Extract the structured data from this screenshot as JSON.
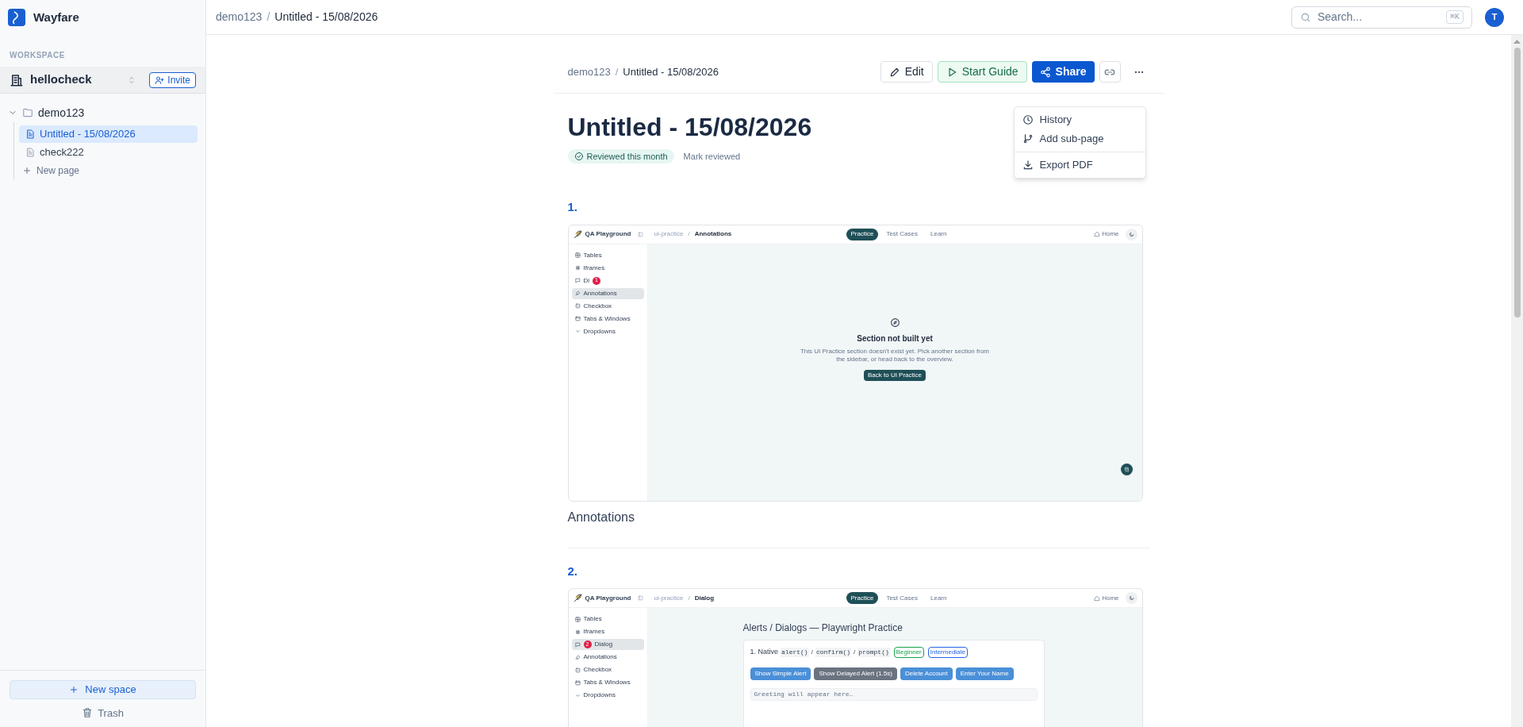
{
  "app": {
    "name": "Wayfare"
  },
  "sidebar": {
    "section_label": "WORKSPACE",
    "workspace": "hellocheck",
    "invite_button": "Invite",
    "tree": [
      {
        "label": "demo123",
        "kind": "folder",
        "expanded": true,
        "children": [
          {
            "label": "Untitled - 15/08/2026",
            "kind": "page",
            "selected": true
          },
          {
            "label": "check222",
            "kind": "page",
            "selected": false
          }
        ]
      }
    ],
    "new_page": "New page",
    "new_space_button": "New space",
    "trash": "Trash"
  },
  "top_bar": {
    "breadcrumb": [
      "demo123",
      "Untitled - 15/08/2026"
    ],
    "separator": "/",
    "search": {
      "placeholder": "Search...",
      "shortcut": "⌘K"
    },
    "avatar": "T"
  },
  "document": {
    "breadcrumb": [
      "demo123",
      "Untitled - 15/08/2026"
    ],
    "separator": "/",
    "actions": [
      {
        "kind": "edit",
        "label": "Edit"
      },
      {
        "kind": "guide",
        "label": "Start Guide"
      },
      {
        "kind": "share",
        "label": "Share"
      },
      {
        "kind": "link"
      },
      {
        "kind": "more"
      }
    ],
    "menu": [
      {
        "kind": "history",
        "label": "History",
        "divider_before": false
      },
      {
        "kind": "subpage",
        "label": "Add sub-page",
        "divider_before": false
      },
      {
        "kind": "export",
        "label": "Export PDF",
        "divider_before": true
      }
    ],
    "title": "Untitled - 15/08/2026",
    "review_badge": "Reviewed this month",
    "mark_reviewed": "Mark reviewed",
    "steps": [
      {
        "number": "1.",
        "caption": "Annotations",
        "screenshot": {
          "brand": "QA Playground",
          "breadcrumb": [
            "ui-practice",
            "Annotations"
          ],
          "separator": "/",
          "tabs": [
            {
              "label": "Practice",
              "selected": true
            },
            {
              "label": "Test Cases",
              "selected": false
            },
            {
              "label": "Learn",
              "selected": false
            }
          ],
          "home": "Home",
          "nav": [
            {
              "kind": "table",
              "label": "Tables",
              "selected": false
            },
            {
              "kind": "frames",
              "label": "Iframes",
              "selected": false
            },
            {
              "kind": "dialog",
              "label": "Di",
              "selected": false,
              "click_badge": "1"
            },
            {
              "kind": "annotate",
              "label": "Annotations",
              "selected": true
            },
            {
              "kind": "checkbox",
              "label": "Checkbox",
              "selected": false
            },
            {
              "kind": "window",
              "label": "Tabs & Windows",
              "selected": false
            },
            {
              "kind": "group",
              "label": "Dropdowns",
              "selected": false
            }
          ],
          "content": {
            "kind": "empty",
            "title": "Section not built yet",
            "text": "This UI Practice section doesn't exist yet. Pick another section from the sidebar, or head back to the overview.",
            "button": "Back to UI Practice"
          }
        }
      },
      {
        "number": "2.",
        "screenshot": {
          "brand": "QA Playground",
          "breadcrumb": [
            "ui-practice",
            "Dialog"
          ],
          "separator": "/",
          "tabs": [
            {
              "label": "Practice",
              "selected": true
            },
            {
              "label": "Test Cases",
              "selected": false
            },
            {
              "label": "Learn",
              "selected": false
            }
          ],
          "home": "Home",
          "nav": [
            {
              "kind": "table",
              "label": "Tables",
              "selected": false
            },
            {
              "kind": "frames",
              "label": "Iframes",
              "selected": false
            },
            {
              "kind": "dialog",
              "label": "Dialog",
              "selected": true,
              "click_badge": "2"
            },
            {
              "kind": "annotate",
              "label": "Annotations",
              "selected": false
            },
            {
              "kind": "checkbox",
              "label": "Checkbox",
              "selected": false
            },
            {
              "kind": "window",
              "label": "Tabs & Windows",
              "selected": false
            },
            {
              "kind": "group",
              "label": "Dropdowns",
              "selected": false
            }
          ],
          "content": {
            "kind": "dialogs",
            "heading": "Alerts / Dialogs — Playwright Practice",
            "card_title": "1. Native",
            "codes": [
              "alert()",
              "confirm()",
              "prompt()"
            ],
            "separator": "/",
            "tags": [
              {
                "label": "Beginner",
                "color": "#16a34a"
              },
              {
                "label": "Intermediate",
                "color": "#2563eb"
              }
            ],
            "buttons": [
              {
                "label": "Show Simple Alert",
                "color": "#4a8fd8"
              },
              {
                "label": "Show Delayed Alert (1.5s)",
                "color": "#6b7280"
              },
              {
                "label": "Delete Account",
                "color": "#4a8fd8"
              },
              {
                "label": "Enter Your Name",
                "color": "#4a8fd8"
              }
            ],
            "output": "Greeting will appear here…"
          }
        }
      }
    ]
  }
}
